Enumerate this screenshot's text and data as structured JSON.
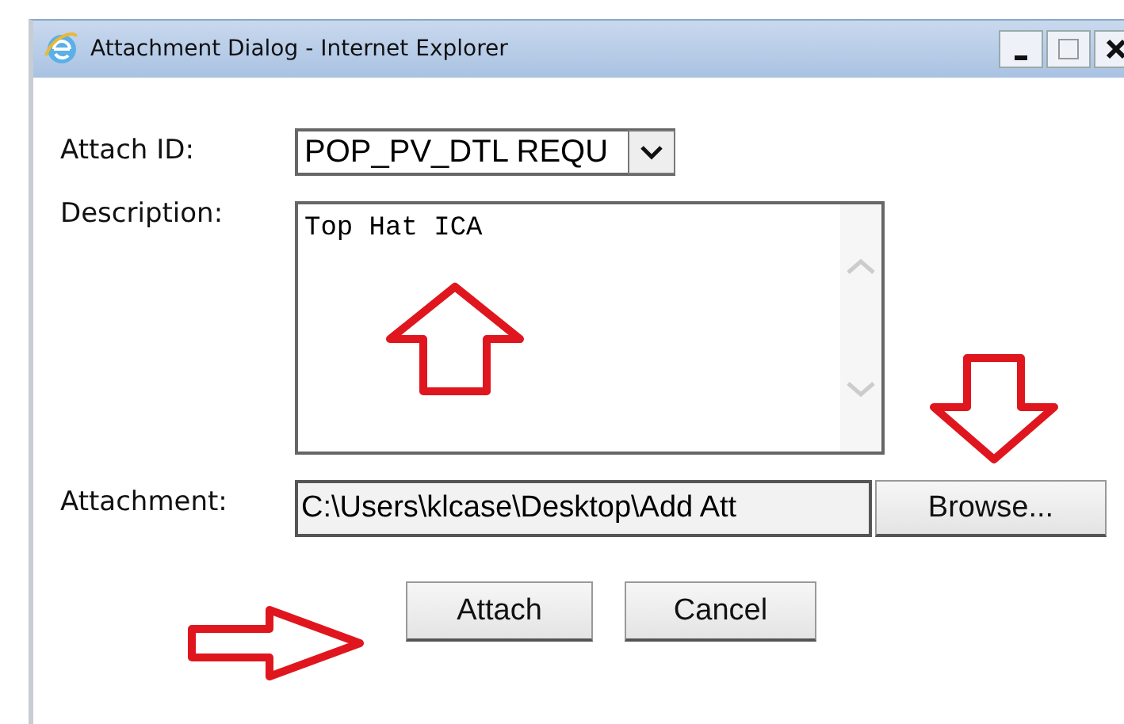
{
  "window": {
    "title": "Attachment Dialog - Internet Explorer"
  },
  "attach_id": {
    "label": "Attach ID:",
    "value": "POP_PV_DTL REQU"
  },
  "description": {
    "label": "Description:",
    "value": "Top Hat ICA"
  },
  "attachment": {
    "label": "Attachment:",
    "value": "C:\\Users\\klcase\\Desktop\\Add Att",
    "browse": "Browse..."
  },
  "buttons": [
    "Attach",
    "Cancel"
  ]
}
